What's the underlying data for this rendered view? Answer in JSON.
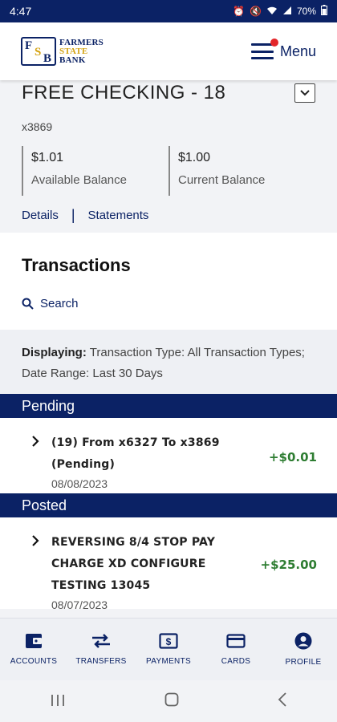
{
  "status_bar": {
    "time": "4:47",
    "battery": "70%"
  },
  "header": {
    "bank_name_line1": "FARMERS",
    "bank_name_line2": "STATE",
    "bank_name_line3": "BANK",
    "logo_letters": [
      "F",
      "S",
      "B"
    ],
    "menu_label": "Menu"
  },
  "account": {
    "title": "FREE CHECKING - 18",
    "number": "x3869",
    "available_amount": "$1.01",
    "available_label": "Available Balance",
    "current_amount": "$1.00",
    "current_label": "Current Balance",
    "details_link": "Details",
    "separator": "|",
    "statements_link": "Statements"
  },
  "transactions": {
    "heading": "Transactions",
    "search_label": "Search",
    "filter_prefix": "Displaying:",
    "filter_text": " Transaction Type: All Transaction Types; Date Range: Last 30 Days"
  },
  "pending": {
    "label": "Pending",
    "items": [
      {
        "description": "(19) From x6327 To x3869 (Pending)",
        "date": "08/08/2023",
        "amount": "+$0.01"
      }
    ]
  },
  "posted": {
    "label": "Posted",
    "items": [
      {
        "description": "REVERSING 8/4 STOP PAY CHARGE XD CONFIGURE TESTING 13045",
        "date": "08/07/2023",
        "amount": "+$25.00"
      }
    ]
  },
  "bottom_nav": {
    "items": [
      {
        "label": "ACCOUNTS",
        "icon": "wallet-icon"
      },
      {
        "label": "TRANSFERS",
        "icon": "transfer-arrows-icon"
      },
      {
        "label": "PAYMENTS",
        "icon": "dollar-bill-icon"
      },
      {
        "label": "CARDS",
        "icon": "credit-card-icon"
      },
      {
        "label": "PROFILE",
        "icon": "profile-icon"
      }
    ]
  },
  "colors": {
    "brand_navy": "#0b2265",
    "brand_gold": "#d4a312",
    "credit_green": "#2e7d32",
    "notification_red": "#e3262a"
  }
}
